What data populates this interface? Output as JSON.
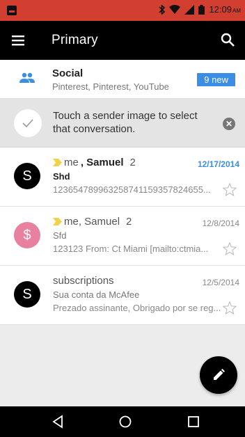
{
  "status_bar": {
    "time": "12:09",
    "ampm": "AM"
  },
  "app_bar": {
    "title": "Primary"
  },
  "social": {
    "label": "Social",
    "snippet": "Pinterest, Pinterest, YouTube",
    "badge": "9 new"
  },
  "tip": {
    "text": "Touch a sender image to select that conversation."
  },
  "threads": [
    {
      "avatar": "S",
      "sender_me": "me",
      "sender_rest": ", Samuel",
      "count": "2",
      "date": "12/17/2014",
      "subject": "Shd",
      "snippet": "123654789963258741159357824655..."
    },
    {
      "avatar": "$",
      "sender_me": "me, Samuel",
      "count": "2",
      "date": "12/8/2014",
      "subject": "Sfd",
      "snippet": "123123 From: Ct Miami [mailto:ctmia..."
    },
    {
      "avatar": "S",
      "sender_me": "subscriptions",
      "count": "",
      "date": "12/5/2014",
      "subject": "Sua conta da McAfee",
      "snippet": "Prezado assinante, Obrigado por se reg..."
    }
  ],
  "colors": {
    "status_bar": "#d23f31",
    "badge": "#3a8ee6",
    "unread_date": "#3a8ee6",
    "importance": "#f2d24b",
    "pink_avatar": "#e8809f"
  },
  "icons": {
    "menu": "hamburger-icon",
    "search": "search-icon",
    "social": "people-icon",
    "tip_check": "check-icon",
    "tip_close": "close-icon",
    "star": "star-outline-icon",
    "compose": "pencil-icon",
    "nav_back": "back-triangle-icon",
    "nav_home": "home-circle-icon",
    "nav_recents": "recents-square-icon"
  }
}
